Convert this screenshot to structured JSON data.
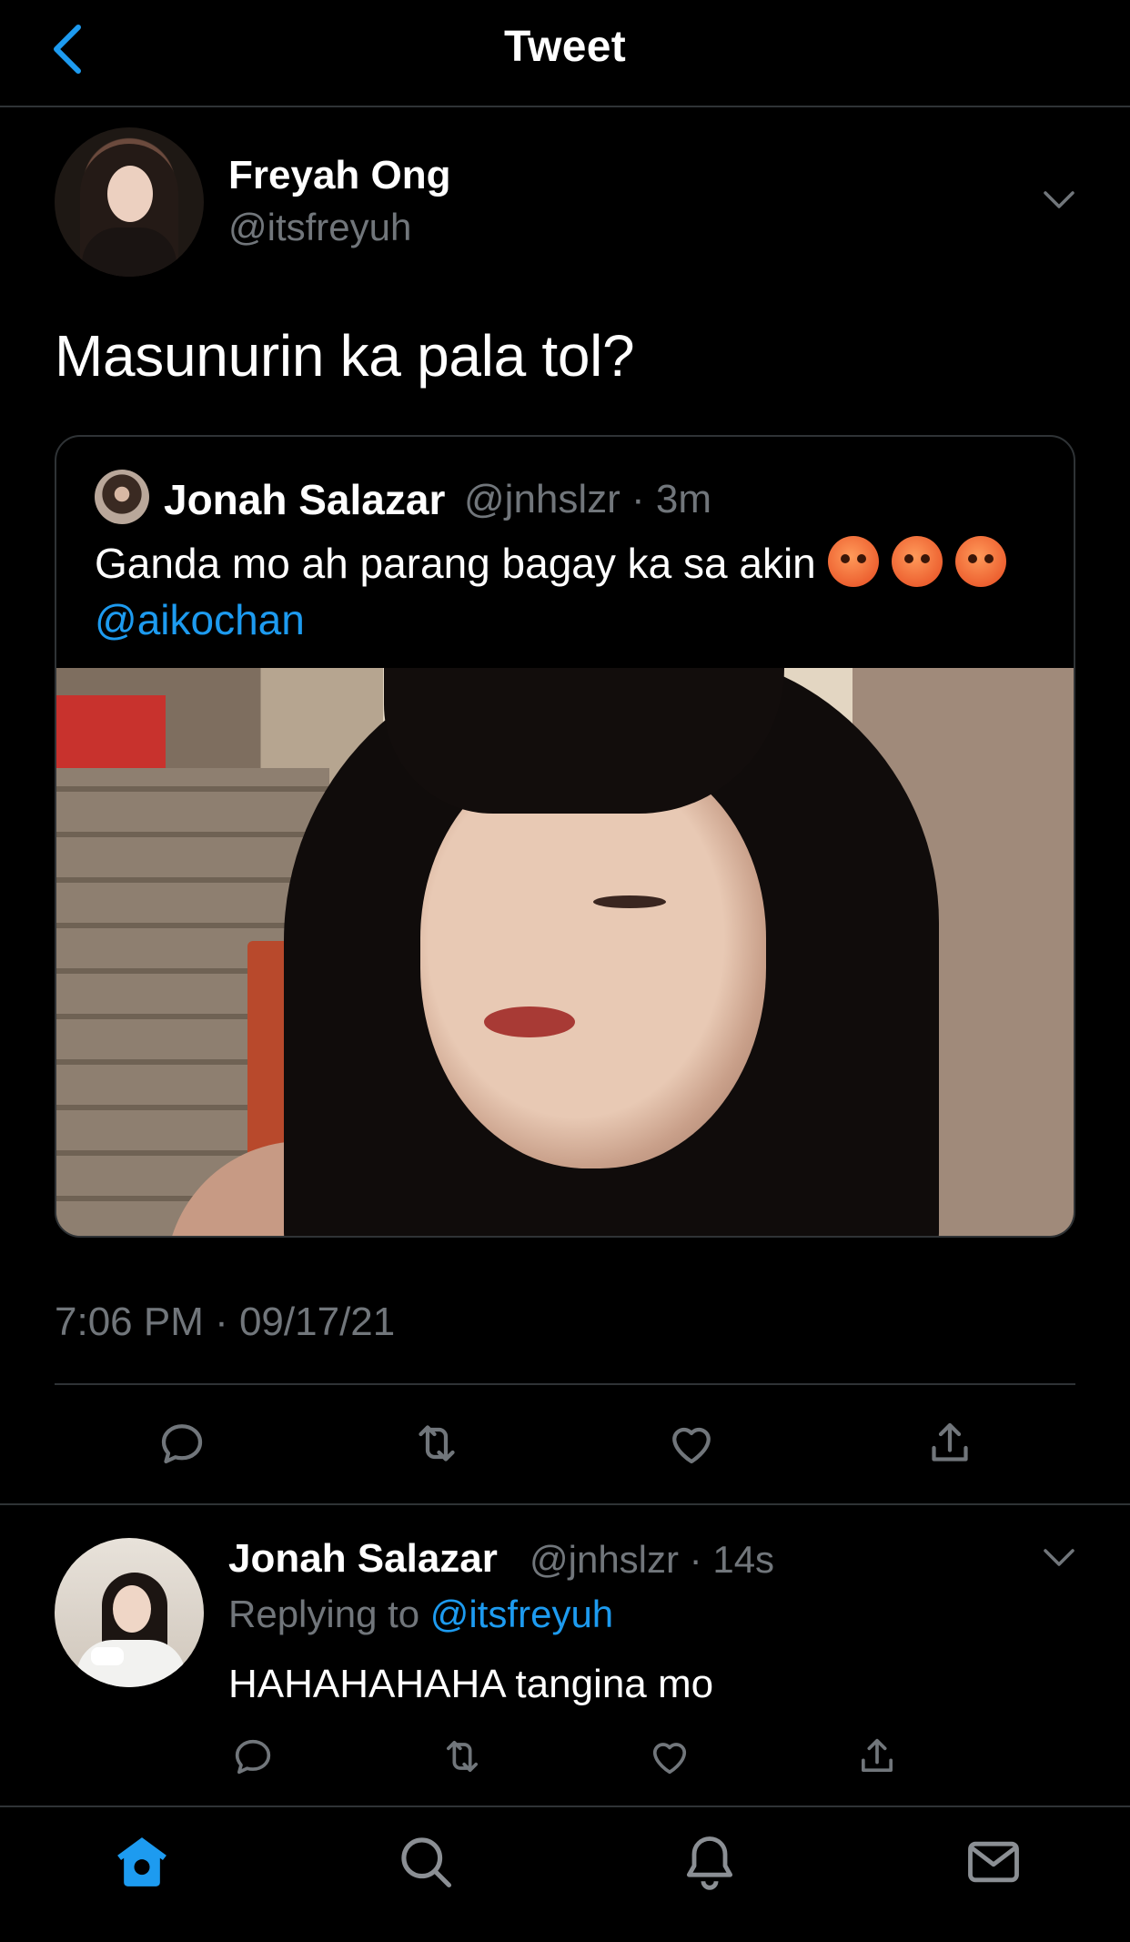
{
  "header": {
    "title": "Tweet"
  },
  "main_tweet": {
    "display_name": "Freyah Ong",
    "handle": "@itsfreyuh",
    "text": "Masunurin ka pala tol?",
    "timestamp": "7:06 PM · 09/17/21"
  },
  "quoted_tweet": {
    "display_name": "Jonah Salazar",
    "handle": "@jnhslzr",
    "time": "3m",
    "text": "Ganda mo ah parang bagay ka sa akin",
    "mention": "@aikochan",
    "emoji": "angry-face"
  },
  "reply": {
    "display_name": "Jonah Salazar",
    "handle": "@jnhslzr",
    "time": "14s",
    "replying_prefix": "Replying to",
    "replying_to": "@itsfreyuh",
    "text": "HAHAHAHAHA tangina mo"
  },
  "icons": {
    "back": "back-chevron-icon",
    "more": "chevron-down-icon",
    "reply": "reply-icon",
    "retweet": "retweet-icon",
    "like": "heart-icon",
    "share": "share-icon",
    "home": "home-icon",
    "search": "search-icon",
    "notifications": "bell-icon",
    "messages": "mail-icon"
  },
  "colors": {
    "background": "#000000",
    "accent": "#1d9bf0",
    "secondary_text": "#71767b",
    "divider": "#2f3336"
  }
}
